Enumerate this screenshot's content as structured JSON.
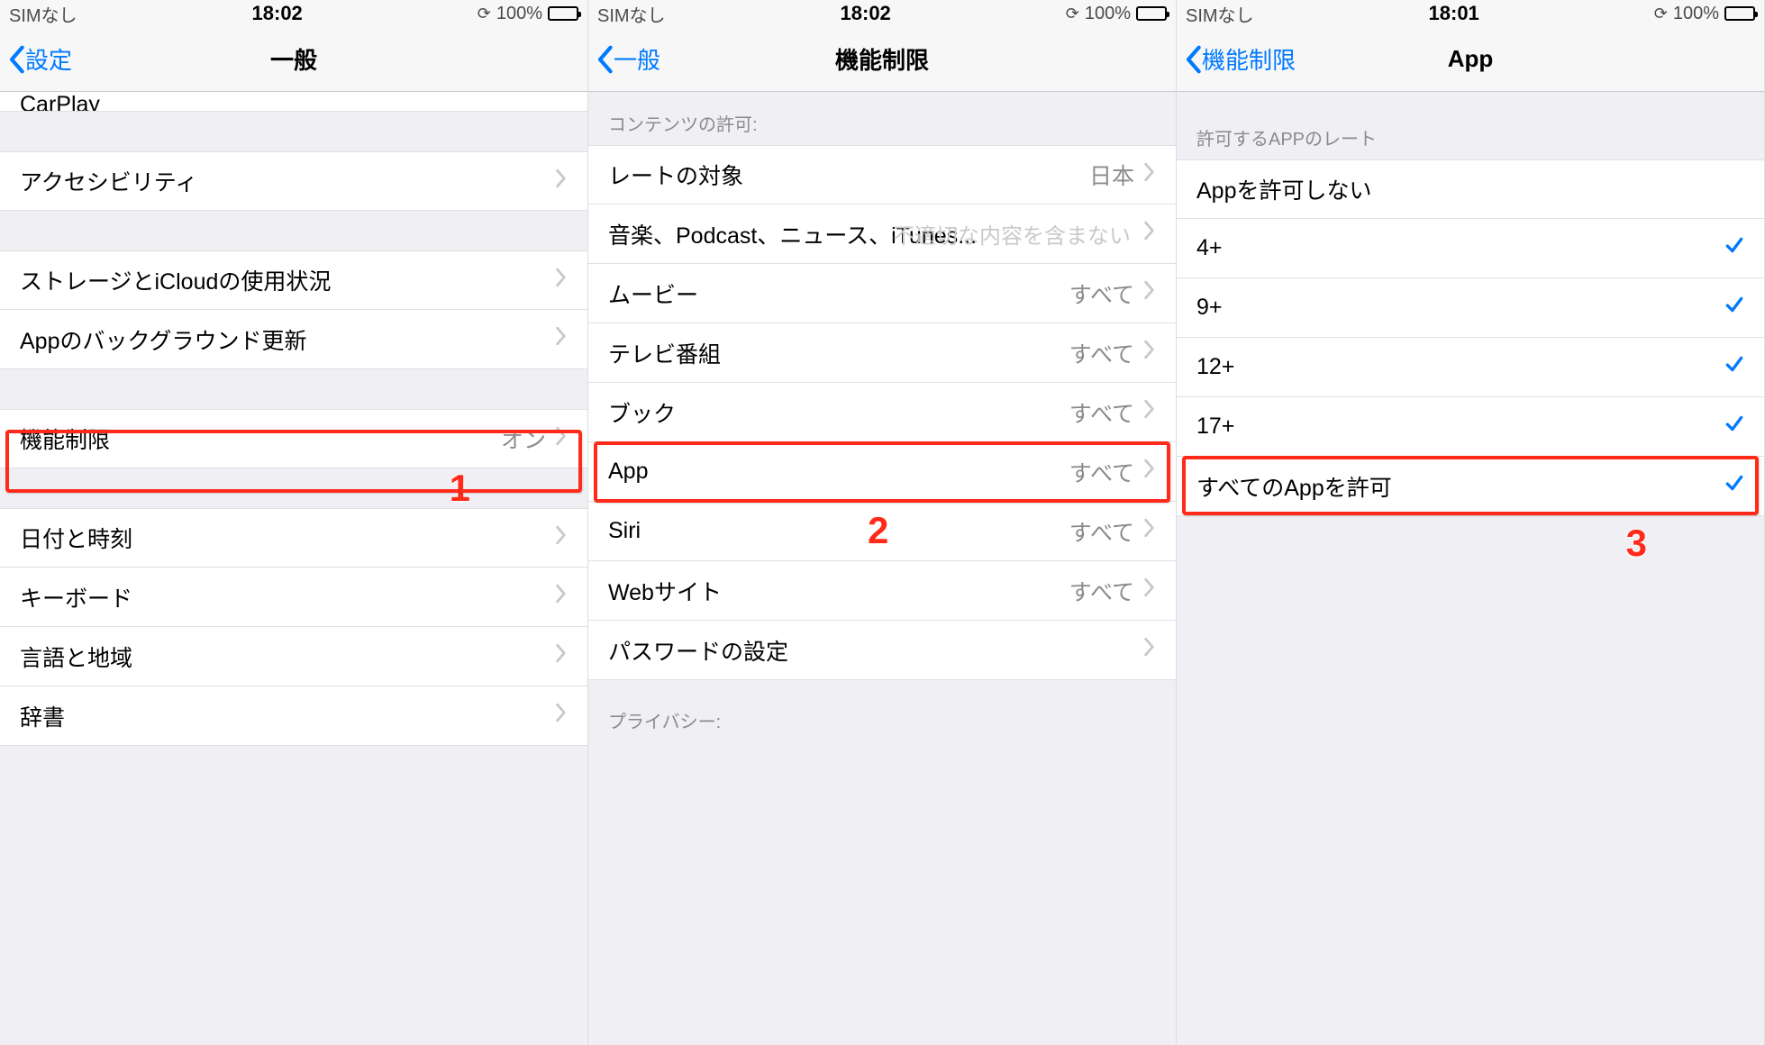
{
  "status": {
    "carrier": "SIMなし",
    "battery_text": "100%"
  },
  "screens": [
    {
      "time": "18:02",
      "back_label": "設定",
      "title": "一般",
      "partial_top": "CarPlay",
      "groups": [
        {
          "type": "gap"
        },
        {
          "type": "cell",
          "label": "アクセシビリティ",
          "value": "",
          "chevron": true
        },
        {
          "type": "gap"
        },
        {
          "type": "cell",
          "label": "ストレージとiCloudの使用状況",
          "value": "",
          "chevron": true
        },
        {
          "type": "cell",
          "label": "Appのバックグラウンド更新",
          "value": "",
          "chevron": true
        },
        {
          "type": "gap"
        },
        {
          "type": "cell",
          "label": "機能制限",
          "value": "オン",
          "chevron": true,
          "highlight": true
        },
        {
          "type": "gap"
        },
        {
          "type": "cell",
          "label": "日付と時刻",
          "value": "",
          "chevron": true
        },
        {
          "type": "cell",
          "label": "キーボード",
          "value": "",
          "chevron": true
        },
        {
          "type": "cell",
          "label": "言語と地域",
          "value": "",
          "chevron": true
        },
        {
          "type": "cell",
          "label": "辞書",
          "value": "",
          "chevron": true
        }
      ],
      "step_number": "1"
    },
    {
      "time": "18:02",
      "back_label": "一般",
      "title": "機能制限",
      "section_header": "コンテンツの許可:",
      "groups": [
        {
          "type": "cell",
          "label": "レートの対象",
          "value": "日本",
          "chevron": true
        },
        {
          "type": "cell",
          "label": "音楽、Podcast、ニュース、iTunes...",
          "value": "不適切な内容を含まない",
          "chevron": true,
          "overlap": true
        },
        {
          "type": "cell",
          "label": "ムービー",
          "value": "すべて",
          "chevron": true
        },
        {
          "type": "cell",
          "label": "テレビ番組",
          "value": "すべて",
          "chevron": true
        },
        {
          "type": "cell",
          "label": "ブック",
          "value": "すべて",
          "chevron": true
        },
        {
          "type": "cell",
          "label": "App",
          "value": "すべて",
          "chevron": true,
          "highlight": true
        },
        {
          "type": "cell",
          "label": "Siri",
          "value": "すべて",
          "chevron": true
        },
        {
          "type": "cell",
          "label": "Webサイト",
          "value": "すべて",
          "chevron": true
        },
        {
          "type": "cell",
          "label": "パスワードの設定",
          "value": "",
          "chevron": true
        }
      ],
      "footer_header": "プライバシー:",
      "step_number": "2"
    },
    {
      "time": "18:01",
      "back_label": "機能制限",
      "title": "App",
      "section_header": "許可するAPPのレート",
      "groups": [
        {
          "type": "cell",
          "label": "Appを許可しない",
          "checked": false
        },
        {
          "type": "cell",
          "label": "4+",
          "checked": true
        },
        {
          "type": "cell",
          "label": "9+",
          "checked": true
        },
        {
          "type": "cell",
          "label": "12+",
          "checked": true
        },
        {
          "type": "cell",
          "label": "17+",
          "checked": true
        },
        {
          "type": "cell",
          "label": "すべてのAppを許可",
          "checked": true,
          "highlight": true
        }
      ],
      "step_number": "3"
    }
  ]
}
